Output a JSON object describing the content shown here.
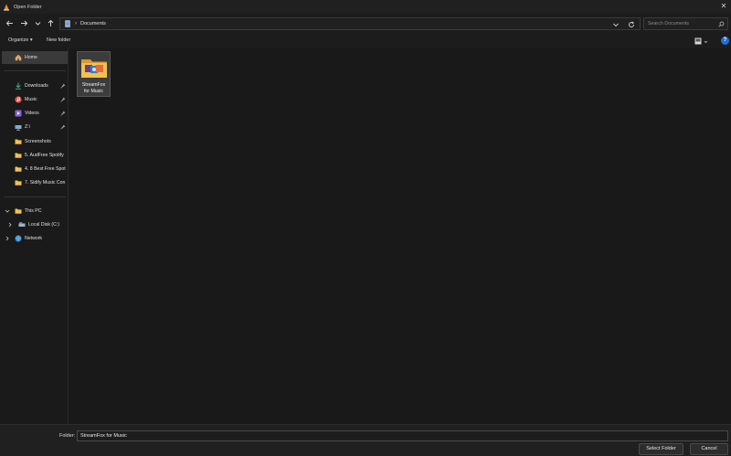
{
  "window": {
    "title": "Open Folder",
    "close_glyph": "✕"
  },
  "address": {
    "crumb_sep": "›",
    "crumb": "Documents",
    "search_placeholder": "Search Documents"
  },
  "toolbar": {
    "organize_label": "Organize ▾",
    "new_folder_label": "New folder",
    "help_glyph": "?"
  },
  "sidebar": {
    "home": "Home",
    "pinned": [
      {
        "label": "Downloads",
        "icon": "download-icon"
      },
      {
        "label": "Music",
        "icon": "music-icon"
      },
      {
        "label": "Videos",
        "icon": "video-icon"
      },
      {
        "label": "Z:\\",
        "icon": "network-drive-icon"
      }
    ],
    "folders": [
      "Screenshots",
      "5. AudFree Spotify",
      "4. 8 Best Free Spot",
      "7. Sidify Music Con"
    ],
    "this_pc": "This PC",
    "local_disk": "Local Disk (C:)",
    "network": "Network"
  },
  "content": {
    "items": [
      {
        "name": "StreamFox for Music",
        "line1": "StreamFox",
        "line2": "for Music"
      }
    ]
  },
  "bottom": {
    "folder_label": "Folder:",
    "folder_value": "StreamFox for Music",
    "select_button": "Select Folder",
    "cancel_button": "Cancel"
  },
  "colors": {
    "accent": "#1e6fd9",
    "folder": "#f2c14e",
    "background": "#191919"
  }
}
